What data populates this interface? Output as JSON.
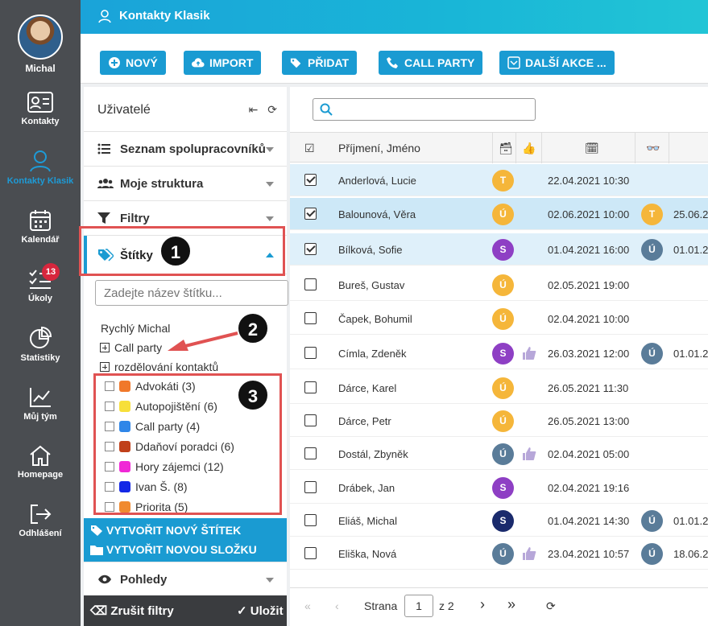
{
  "user": {
    "name": "Michal"
  },
  "rail": [
    {
      "label": "Kontakty",
      "icon": "contacts-card-icon"
    },
    {
      "label": "Kontakty Klasik",
      "icon": "person-icon",
      "active": true
    },
    {
      "label": "Kalendář",
      "icon": "calendar-icon"
    },
    {
      "label": "Úkoly",
      "icon": "tasks-icon",
      "badge": "13"
    },
    {
      "label": "Statistiky",
      "icon": "pie-chart-icon"
    },
    {
      "label": "Můj tým",
      "icon": "trend-chart-icon"
    },
    {
      "label": "Homepage",
      "icon": "home-icon"
    },
    {
      "label": "Odhlášení",
      "icon": "logout-icon"
    }
  ],
  "header": {
    "title": "Kontakty Klasik"
  },
  "toolbar": {
    "new": "NOVÝ",
    "import": "IMPORT",
    "add": "PŘIDAT",
    "call_party": "CALL PARTY",
    "more": "DALŠÍ AKCE ..."
  },
  "panel": {
    "title": "Uživatelé",
    "head_icons": "⇤ ⟳",
    "sections": [
      "Seznam spolupracovníků",
      "Moje struktura",
      "Filtry",
      "Štítky"
    ],
    "tag_placeholder": "Zadejte název štítku...",
    "tree_root": "Rychlý Michal",
    "folders": [
      "Call party",
      "rozdělování kontaktů"
    ],
    "tags": [
      {
        "label": "Advokáti (3)",
        "color": "#f0782a"
      },
      {
        "label": "Autopojištění (6)",
        "color": "#f7df3a"
      },
      {
        "label": "Call party (4)",
        "color": "#2f86e8"
      },
      {
        "label": "Ddaňoví poradci (6)",
        "color": "#c0401a"
      },
      {
        "label": "Hory zájemci (12)",
        "color": "#f028d6"
      },
      {
        "label": "Ivan Š. (8)",
        "color": "#1428e6"
      },
      {
        "label": "Priorita (5)",
        "color": "#f08a30"
      }
    ],
    "create_tag": "VYTVOŘIT NOVÝ ŠTÍTEK",
    "create_folder": "VYTVOŘIT NOVOU SLOŽKU",
    "views": "Pohledy",
    "clear_filters": "Zrušit filtry",
    "save": "Uložit"
  },
  "callouts": [
    "1",
    "2",
    "3"
  ],
  "table": {
    "col_name": "Příjmení, Jméno",
    "rows": [
      {
        "name": "Anderlová, Lucie",
        "c1": "T",
        "c1color": "#f5b63a",
        "date": "22.04.2021 10:30",
        "checked": true,
        "sel": true
      },
      {
        "name": "Balounová, Věra",
        "c1": "Ú",
        "c1color": "#f5b63a",
        "date": "02.06.2021 10:00",
        "c2": "T",
        "c2color": "#f5b63a",
        "date2": "25.06.2",
        "checked": true,
        "sel": true
      },
      {
        "name": "Bílková, Sofie",
        "c1": "S",
        "c1color": "#8e3fc4",
        "date": "01.04.2021 16:00",
        "c2": "Ú",
        "c2color": "#5a7c99",
        "date2": "01.01.2",
        "checked": true,
        "sel": true
      },
      {
        "name": "Bureš, Gustav",
        "c1": "Ú",
        "c1color": "#f5b63a",
        "date": "02.05.2021 19:00"
      },
      {
        "name": "Čapek, Bohumil",
        "c1": "Ú",
        "c1color": "#f5b63a",
        "date": "02.04.2021 10:00"
      },
      {
        "name": "Címla, Zdeněk",
        "c1": "S",
        "c1color": "#8e3fc4",
        "thumb": true,
        "date": "26.03.2021 12:00",
        "c2": "Ú",
        "c2color": "#5a7c99",
        "date2": "01.01.2"
      },
      {
        "name": "Dárce, Karel",
        "c1": "Ú",
        "c1color": "#f5b63a",
        "date": "26.05.2021 11:30"
      },
      {
        "name": "Dárce, Petr",
        "c1": "Ú",
        "c1color": "#f5b63a",
        "date": "26.05.2021 13:00"
      },
      {
        "name": "Dostál, Zbyněk",
        "c1": "Ú",
        "c1color": "#5a7c99",
        "thumb": true,
        "date": "02.04.2021 05:00"
      },
      {
        "name": "Drábek, Jan",
        "c1": "S",
        "c1color": "#8e3fc4",
        "date": "02.04.2021 19:16"
      },
      {
        "name": "Eliáš, Michal",
        "c1": "S",
        "c1color": "#1a2a6c",
        "date": "01.04.2021 14:30",
        "c2": "Ú",
        "c2color": "#5a7c99",
        "date2": "01.01.2"
      },
      {
        "name": "Eliška, Nová",
        "c1": "Ú",
        "c1color": "#5a7c99",
        "thumb": true,
        "date": "23.04.2021 10:57",
        "c2": "Ú",
        "c2color": "#5a7c99",
        "date2": "18.06.2"
      }
    ]
  },
  "pager": {
    "label": "Strana",
    "page": "1",
    "of": "z 2"
  }
}
